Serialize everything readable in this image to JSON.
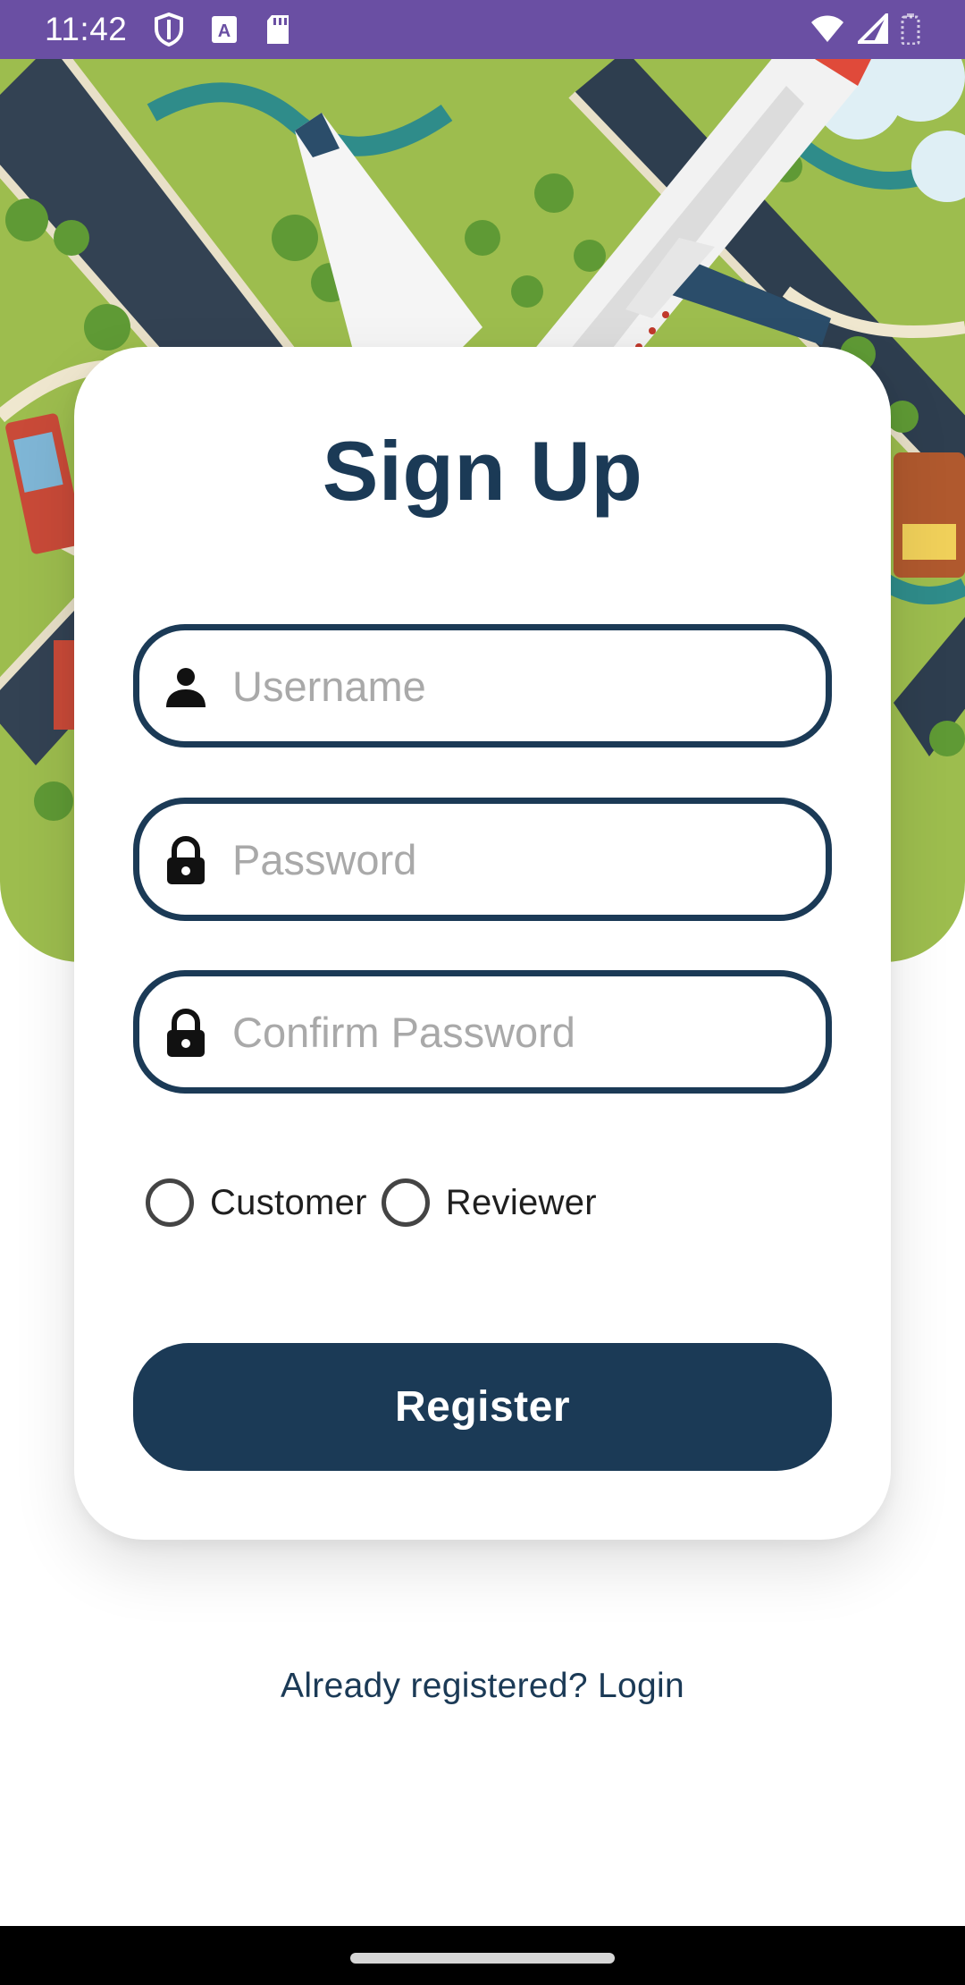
{
  "status_bar": {
    "time": "11:42",
    "left_icons": [
      "shield-icon",
      "keyboard-a-icon",
      "sd-card-icon"
    ],
    "right_icons": [
      "wifi-icon",
      "signal-icon",
      "battery-icon"
    ]
  },
  "hero": {
    "description_icon": "airport-illustration"
  },
  "card": {
    "title": "Sign Up",
    "fields": [
      {
        "placeholder": "Username",
        "value": "",
        "icon": "person-icon"
      },
      {
        "placeholder": "Password",
        "value": "",
        "icon": "lock-icon"
      },
      {
        "placeholder": "Confirm Password",
        "value": "",
        "icon": "lock-icon"
      }
    ],
    "roles": [
      {
        "label": "Customer",
        "selected": false
      },
      {
        "label": "Reviewer",
        "selected": false
      }
    ],
    "register_label": "Register"
  },
  "footer": {
    "login_link": "Already registered? Login"
  },
  "colors": {
    "primary": "#1b3a56",
    "status_bar": "#6a4fa3",
    "placeholder": "#a9a9a9",
    "background": "#ffffff"
  }
}
